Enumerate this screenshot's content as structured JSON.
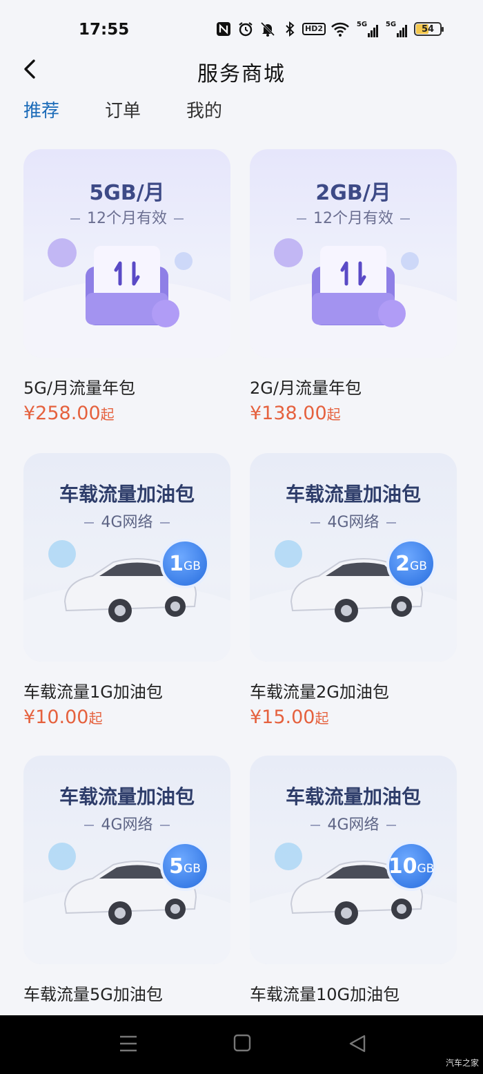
{
  "status_bar": {
    "time": "17:55",
    "hd_label": "HD2",
    "signal1": "5G",
    "signal2": "5G",
    "battery": "54",
    "battery_level": 0.54,
    "icons": [
      "nfc-icon",
      "alarm-icon",
      "mute-icon",
      "bluetooth-icon",
      "hd-icon",
      "wifi-icon",
      "signal-icon",
      "signal-icon",
      "battery-icon"
    ]
  },
  "header": {
    "back_icon": "chevron-left-icon",
    "title": "服务商城"
  },
  "tabs": [
    {
      "label": "推荐",
      "active": true
    },
    {
      "label": "订单",
      "active": false
    },
    {
      "label": "我的",
      "active": false
    }
  ],
  "products": [
    {
      "kind": "package",
      "banner_title": "5GB/月",
      "banner_sub": "12个月有效",
      "name": "5G/月流量年包",
      "price": "¥258.00",
      "price_suffix": "起"
    },
    {
      "kind": "package",
      "banner_title": "2GB/月",
      "banner_sub": "12个月有效",
      "name": "2G/月流量年包",
      "price": "¥138.00",
      "price_suffix": "起"
    },
    {
      "kind": "car",
      "banner_title": "车载流量加油包",
      "banner_sub": "4G网络",
      "badge_num": "1",
      "badge_unit": "GB",
      "name": "车载流量1G加油包",
      "price": "¥10.00",
      "price_suffix": "起"
    },
    {
      "kind": "car",
      "banner_title": "车载流量加油包",
      "banner_sub": "4G网络",
      "badge_num": "2",
      "badge_unit": "GB",
      "name": "车载流量2G加油包",
      "price": "¥15.00",
      "price_suffix": "起"
    },
    {
      "kind": "car",
      "banner_title": "车载流量加油包",
      "banner_sub": "4G网络",
      "badge_num": "5",
      "badge_unit": "GB",
      "name": "车载流量5G加油包",
      "price": "",
      "price_suffix": ""
    },
    {
      "kind": "car",
      "banner_title": "车载流量加油包",
      "banner_sub": "4G网络",
      "badge_num": "10",
      "badge_unit": "GB",
      "name": "车载流量10G加油包",
      "price": "",
      "price_suffix": ""
    }
  ],
  "nav_bar": {
    "icons": [
      "menu-icon",
      "home-square-icon",
      "back-triangle-icon"
    ]
  },
  "watermark": "汽车之家",
  "colors": {
    "accent": "#1a6ab8",
    "price": "#e5613e",
    "badge": "#3c7fe8"
  }
}
